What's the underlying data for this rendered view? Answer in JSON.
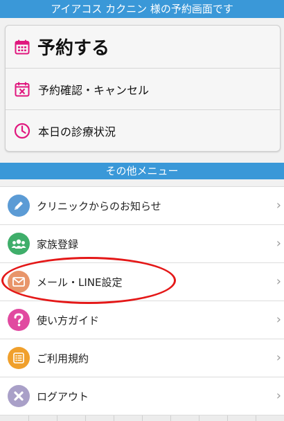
{
  "header": {
    "title": "アイアコス カクニン 様の予約画面です"
  },
  "main_actions": {
    "reserve": {
      "label": "予約する",
      "icon": "calendar-icon"
    },
    "confirm_cancel": {
      "label": "予約確認・キャンセル",
      "icon": "calendar-cancel-icon"
    },
    "today_status": {
      "label": "本日の診療状況",
      "icon": "clock-icon"
    }
  },
  "other_menu": {
    "title": "その他メニュー",
    "items": [
      {
        "label": "クリニックからのお知らせ",
        "icon": "pencil-icon",
        "color": "#5b9bd5"
      },
      {
        "label": "家族登録",
        "icon": "family-icon",
        "color": "#3fae6a"
      },
      {
        "label": "メール・LINE設定",
        "icon": "mail-icon",
        "color": "#e8956a"
      },
      {
        "label": "使い方ガイド",
        "icon": "question-icon",
        "color": "#e14aa0"
      },
      {
        "label": "ご利用規約",
        "icon": "list-icon",
        "color": "#f0a02c"
      },
      {
        "label": "ログアウト",
        "icon": "close-icon",
        "color": "#a9a0c8"
      }
    ]
  },
  "colors": {
    "accent": "#3a98d8",
    "icon_pink": "#e0177e",
    "highlight": "#e41818"
  },
  "chevron": "›"
}
